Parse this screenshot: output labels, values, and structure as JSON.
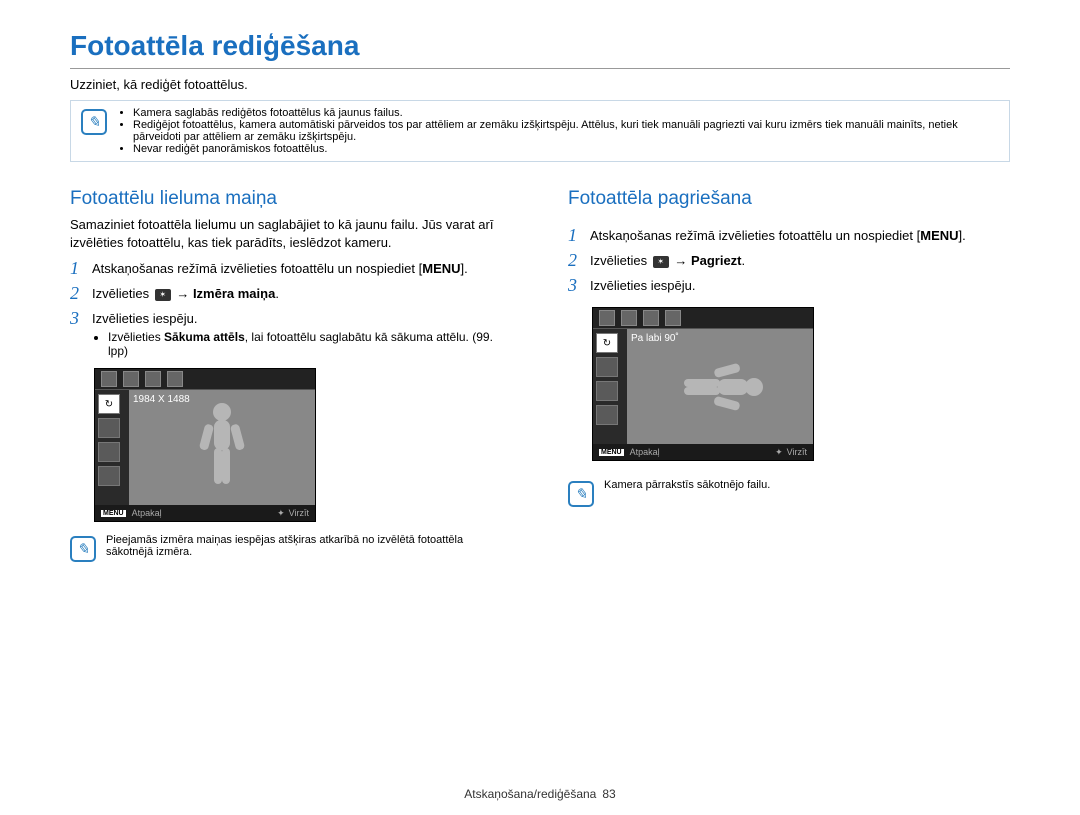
{
  "header": {
    "title": "Fotoattēla rediģēšana",
    "intro": "Uzziniet, kā rediģēt fotoattēlus.",
    "top_notes": [
      "Kamera saglabās rediģētos fotoattēlus kā jaunus failus.",
      "Rediģējot fotoattēlus, kamera automātiski pārveidos tos par attēliem ar zemāku izšķirtspēju. Attēlus, kuri tiek manuāli pagriezti vai kuru izmērs tiek manuāli mainīts, netiek pārveidoti par attēliem ar zemāku izšķirtspēju.",
      "Nevar rediģēt panorāmiskos fotoattēlus."
    ]
  },
  "left": {
    "title": "Fotoattēlu lieluma maiņa",
    "body": "Samaziniet fotoattēla lielumu un saglabājiet to kā jaunu failu. Jūs varat arī izvēlēties fotoattēlu, kas tiek parādīts, ieslēdzot kameru.",
    "step1_a": "Atskaņošanas režīmā izvēlieties fotoattēlu un nospiediet ",
    "step1_menu": "MENU",
    "step2_a": "Izvēlieties ",
    "step2_b": " → ",
    "step2_bold": "Izmēra maiņa",
    "step3": "Izvēlieties iespēju.",
    "sub_a": "Izvēlieties ",
    "sub_bold": "Sākuma attēls",
    "sub_b": ", lai fotoattēlu saglabātu kā sākuma attēlu. (99. lpp)",
    "screen_label": "1984 X 1488",
    "screen_back": "Atpakaļ",
    "screen_scroll": "Virzīt",
    "note": "Pieejamās izmēra maiņas iespējas atšķiras atkarībā no izvēlētā fotoattēla sākotnējā izmēra."
  },
  "right": {
    "title": "Fotoattēla pagriešana",
    "step1_a": "Atskaņošanas režīmā izvēlieties fotoattēlu un nospiediet ",
    "step1_menu": "MENU",
    "step2_a": "Izvēlieties ",
    "step2_b": " → ",
    "step2_bold": "Pagriezt",
    "step3": "Izvēlieties iespēju.",
    "screen_label": "Pa labi 90˚",
    "screen_back": "Atpakaļ",
    "screen_scroll": "Virzīt",
    "note": "Kamera pārrakstīs sākotnējo failu."
  },
  "footer": {
    "section": "Atskaņošana/rediģēšana",
    "page": "83"
  }
}
